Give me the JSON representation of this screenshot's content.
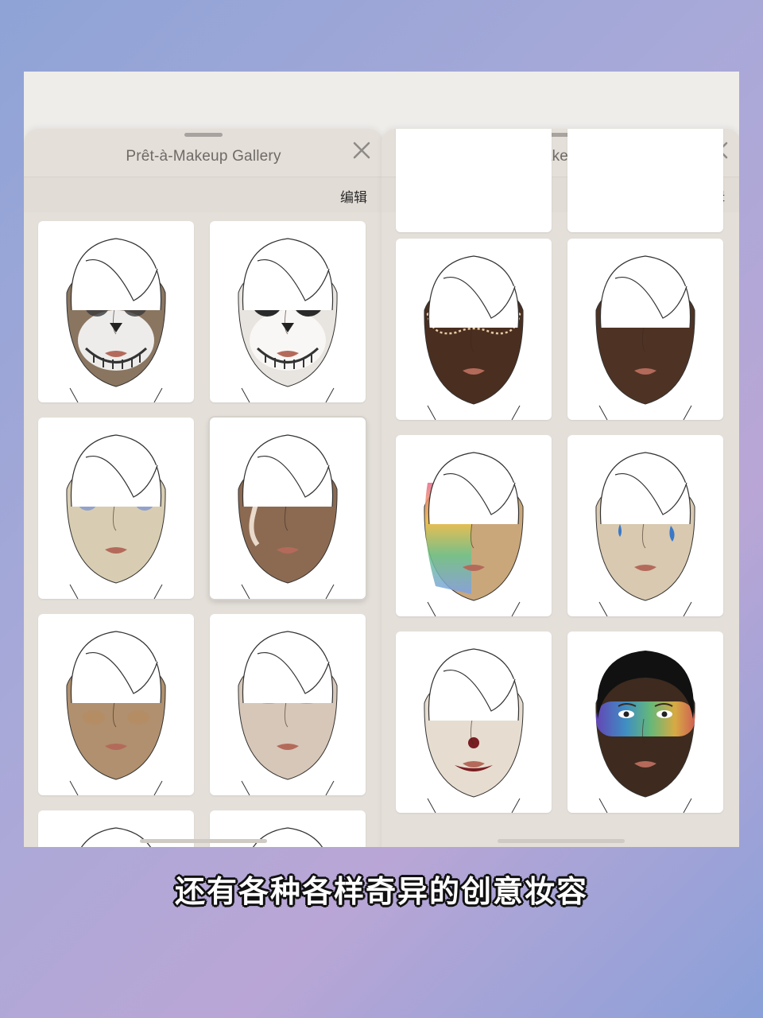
{
  "panels": [
    {
      "title": "Prêt-à-Makeup Gallery",
      "edit_label": "编辑",
      "close_icon": "close-icon",
      "cards": [
        {
          "look": "skull",
          "skin": "#8a7560",
          "accent": "#2a2a2a"
        },
        {
          "look": "sugar-skull",
          "skin": "#e8e4df",
          "accent": "#c0505e"
        },
        {
          "look": "blue-lash",
          "skin": "#d8cdb2",
          "accent": "#5b7fe0"
        },
        {
          "look": "white-swirl",
          "skin": "#8c6a52",
          "accent": "#f3e7d8",
          "selected": true
        },
        {
          "look": "bronze-glow",
          "skin": "#b0906e",
          "accent": "#c08a55"
        },
        {
          "look": "soft-pink",
          "skin": "#d7c7b8",
          "accent": "#e0707e"
        },
        {
          "look": "partial",
          "skin": "#9a8470",
          "accent": "#6b5a4a"
        },
        {
          "look": "partial",
          "skin": "#d9ccbe",
          "accent": "#6b5a4a"
        }
      ]
    },
    {
      "title": "Prêt-à-Makeup Gallery",
      "edit_label": "编辑",
      "close_icon": "close-icon",
      "cards": [
        {
          "look": "lace-mask",
          "skin": "#4a2e1f",
          "accent": "#e8cba6"
        },
        {
          "look": "natural-dark",
          "skin": "#4e3324",
          "accent": "#3a2418"
        },
        {
          "look": "rainbow-leopard",
          "skin": "#c9a77a",
          "accent": "#e86a8c"
        },
        {
          "look": "pop-art",
          "skin": "#d8c9b0",
          "accent": "#3a78c8"
        },
        {
          "look": "clown",
          "skin": "#e6dcd0",
          "accent": "#7a1e22"
        },
        {
          "look": "galaxy",
          "skin": "#3e2a1e",
          "accent": "#6a4ad0"
        }
      ]
    }
  ],
  "caption": "还有各种各样奇异的创意妆容"
}
